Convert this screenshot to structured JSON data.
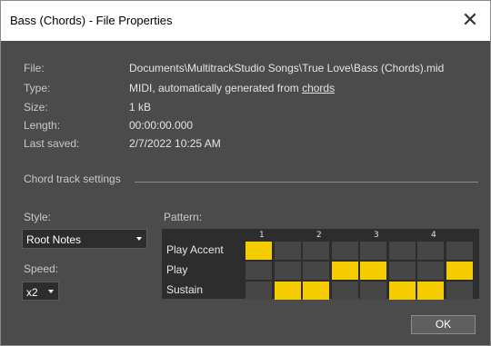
{
  "window": {
    "title": "Bass (Chords) - File Properties",
    "close_glyph": "✕"
  },
  "file": {
    "file_label": "File:",
    "file_value": "Documents\\MultitrackStudio Songs\\True Love\\Bass (Chords).mid",
    "type_label": "Type:",
    "type_prefix": "MIDI, automatically generated from ",
    "type_link": "chords",
    "size_label": "Size:",
    "size_value": "1 kB",
    "length_label": "Length:",
    "length_value": "00:00:00.000",
    "saved_label": "Last saved:",
    "saved_value": "2/7/2022 10:25 AM"
  },
  "chord": {
    "section_title": "Chord track settings",
    "style_label": "Style:",
    "style_value": "Root Notes",
    "speed_label": "Speed:",
    "speed_value": "x2",
    "pattern_label": "Pattern:",
    "beats": [
      "1",
      "2",
      "3",
      "4"
    ],
    "rows": [
      {
        "label": "Play Accent",
        "cells": [
          1,
          0,
          0,
          0,
          0,
          0,
          0,
          0
        ]
      },
      {
        "label": "Play",
        "cells": [
          0,
          0,
          0,
          1,
          1,
          0,
          0,
          1
        ]
      },
      {
        "label": "Sustain",
        "cells": [
          0,
          1,
          1,
          0,
          0,
          1,
          1,
          0
        ]
      }
    ]
  },
  "buttons": {
    "ok": "OK"
  },
  "colors": {
    "pattern_on": "#f5cc00",
    "pattern_off": "#464646",
    "background": "#4b4b4b"
  }
}
